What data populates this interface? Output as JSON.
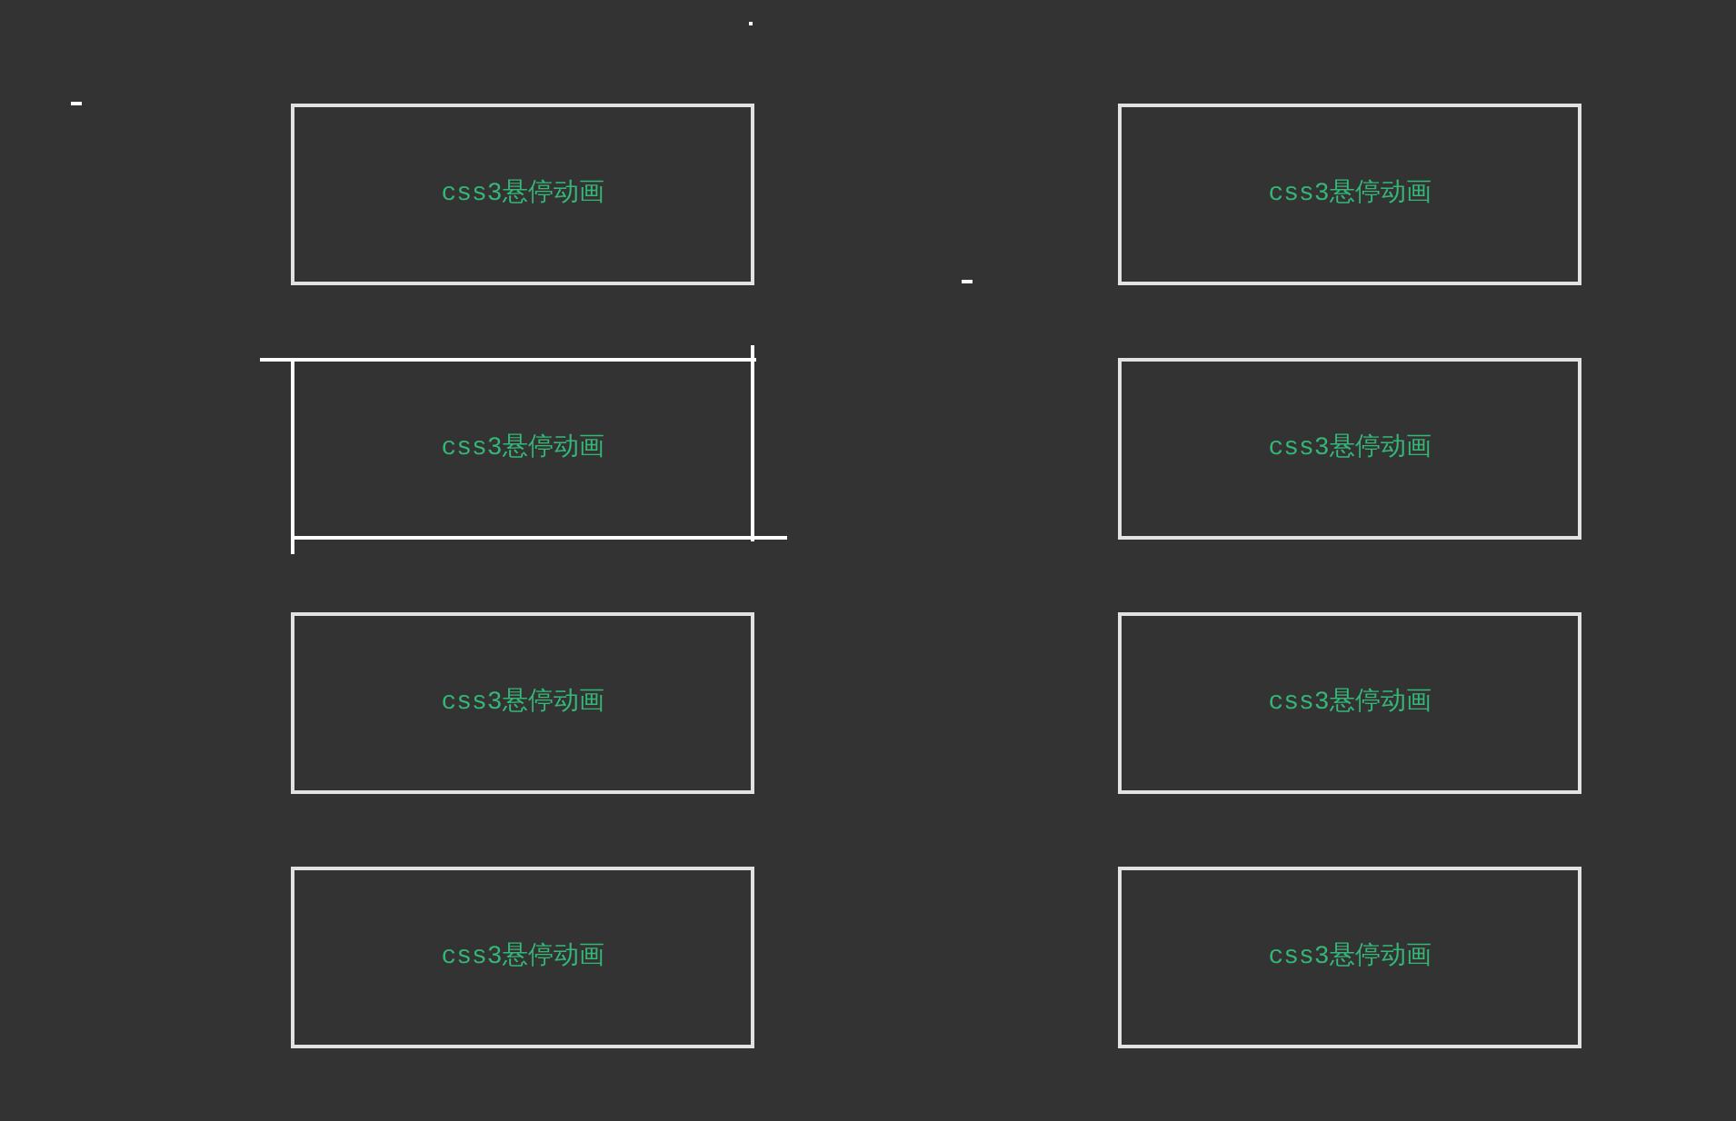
{
  "cards": [
    {
      "label": "css3悬停动画",
      "hovered": false
    },
    {
      "label": "css3悬停动画",
      "hovered": false
    },
    {
      "label": "css3悬停动画",
      "hovered": true
    },
    {
      "label": "css3悬停动画",
      "hovered": false
    },
    {
      "label": "css3悬停动画",
      "hovered": false
    },
    {
      "label": "css3悬停动画",
      "hovered": false
    },
    {
      "label": "css3悬停动画",
      "hovered": false
    },
    {
      "label": "css3悬停动画",
      "hovered": false
    }
  ]
}
